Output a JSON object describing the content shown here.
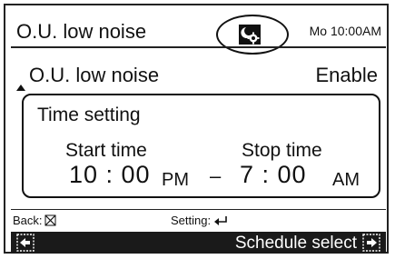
{
  "header": {
    "title": "O.U. low noise",
    "clock": "Mo 10:00AM",
    "status_icon": "night-mode-gear-icon"
  },
  "setting": {
    "label": "O.U. low noise",
    "value": "Enable"
  },
  "time_setting": {
    "title": "Time setting",
    "start_label": "Start time",
    "start_time": "10 : 00",
    "start_ampm": "PM",
    "separator": "–",
    "stop_label": "Stop time",
    "stop_time": "7 : 00",
    "stop_ampm": "AM"
  },
  "footer": {
    "back_label": "Back:",
    "back_icon": "cancel-x-icon",
    "setting_label": "Setting:",
    "setting_icon": "enter-arrow-icon",
    "schedule_select_label": "Schedule select"
  }
}
